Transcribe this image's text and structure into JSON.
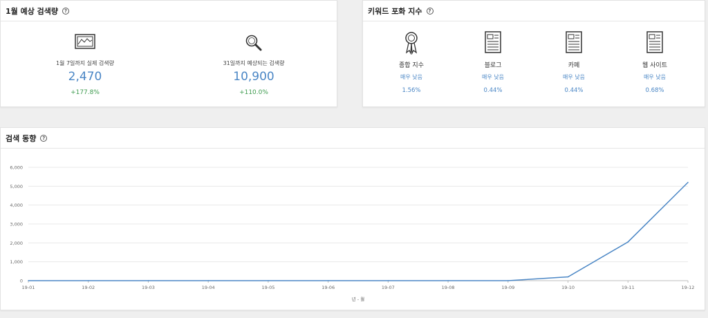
{
  "monthly": {
    "title": "1월 예상 검색량",
    "help": "?",
    "actual": {
      "label": "1월 7일까지 실제 검색량",
      "value": "2,470",
      "change": "+177.8%"
    },
    "expected": {
      "label": "31일까지 예상되는 검색량",
      "value": "10,900",
      "change": "+110.0%"
    }
  },
  "saturation": {
    "title": "키워드 포화 지수",
    "help": "?",
    "items": [
      {
        "label": "종합 지수",
        "level": "매우 낮음",
        "pct": "1.56%",
        "icon": "award-ribbon-icon"
      },
      {
        "label": "블로그",
        "level": "매우 낮음",
        "pct": "0.44%",
        "icon": "document-icon"
      },
      {
        "label": "카페",
        "level": "매우 낮음",
        "pct": "0.44%",
        "icon": "document-icon"
      },
      {
        "label": "웹 사이트",
        "level": "매우 낮음",
        "pct": "0.68%",
        "icon": "document-icon"
      }
    ]
  },
  "trend": {
    "title": "검색 동향",
    "help": "?"
  },
  "colors": {
    "accent": "#4a86c5",
    "positive": "#3c9a4d"
  },
  "chart_data": {
    "type": "line",
    "title": "",
    "xlabel": "년 - 월",
    "ylabel": "",
    "x": [
      "19-01",
      "19-02",
      "19-03",
      "19-04",
      "19-05",
      "19-06",
      "19-07",
      "19-08",
      "19-09",
      "19-10",
      "19-11",
      "19-12"
    ],
    "series": [
      {
        "values": [
          0,
          0,
          0,
          0,
          0,
          0,
          0,
          0,
          0,
          200,
          2050,
          5200
        ]
      }
    ],
    "ylim": [
      0,
      6000
    ],
    "yticks": [
      "0",
      "1,000",
      "2,000",
      "3,000",
      "4,000",
      "5,000",
      "6,000"
    ],
    "grid": true,
    "color": "#4a86c5"
  }
}
